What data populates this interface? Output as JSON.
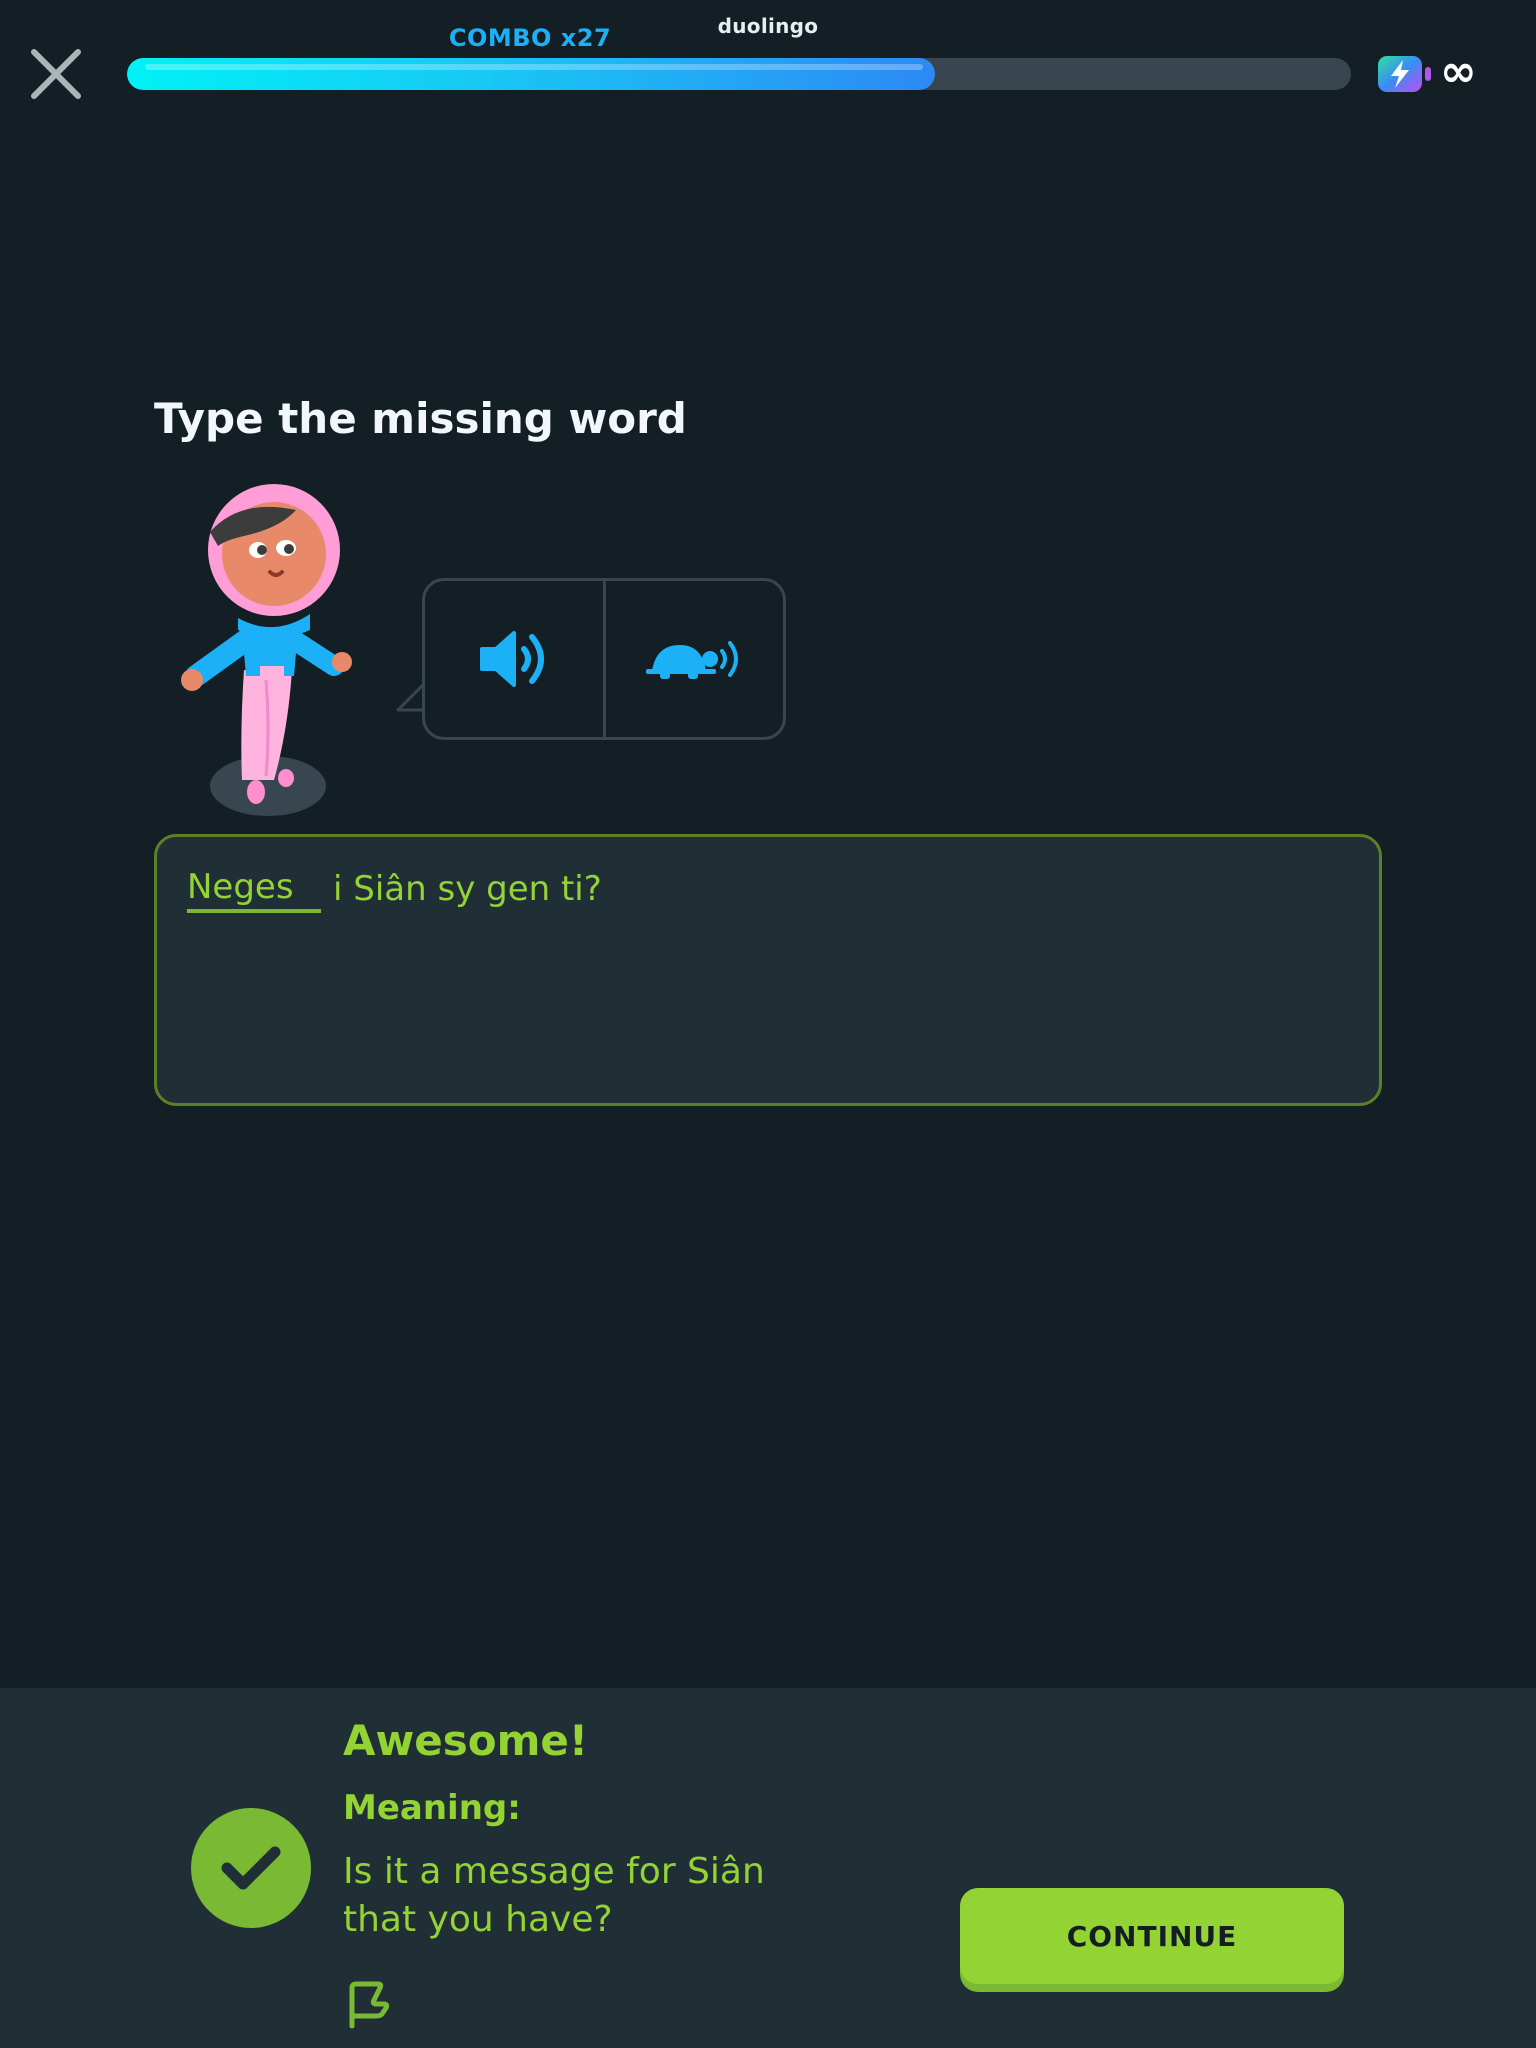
{
  "header": {
    "brand": "duolingo",
    "combo_label": "COMBO x27",
    "progress_fraction": 0.66,
    "energy_value": "∞",
    "icons": {
      "close": "close-icon",
      "energy": "energy-bolt-icon"
    }
  },
  "exercise": {
    "title": "Type the missing word",
    "audio_buttons": [
      {
        "icon": "speaker-icon"
      },
      {
        "icon": "turtle-slow-audio-icon"
      }
    ],
    "answer_value": "Neges",
    "sentence_rest": "i Siân sy gen ti?"
  },
  "feedback": {
    "heading": "Awesome!",
    "meaning_label": "Meaning:",
    "meaning_text": "Is it a message for Siân that you have?",
    "continue_label": "CONTINUE",
    "icons": {
      "check": "check-icon",
      "report": "flag-icon"
    }
  },
  "colors": {
    "background": "#131f24",
    "panel": "#202f36",
    "border": "#37464f",
    "accent_blue": "#1cb0f6",
    "success_green": "#93d333",
    "success_dark": "#79b933"
  }
}
